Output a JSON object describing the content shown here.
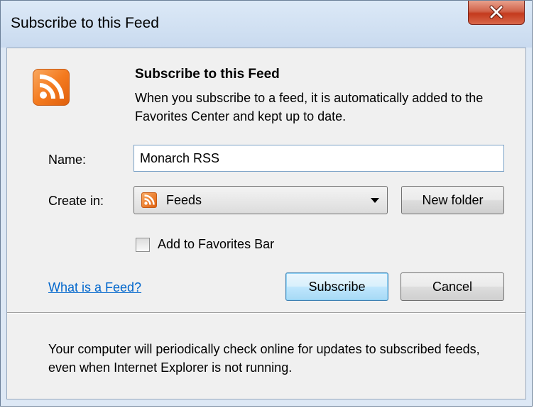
{
  "window": {
    "title": "Subscribe to this Feed"
  },
  "header": {
    "icon": "rss-feed-icon",
    "heading": "Subscribe to this Feed",
    "description": "When you subscribe to a feed, it is automatically added to the Favorites Center and kept up to date."
  },
  "form": {
    "name_label": "Name:",
    "name_value": "Monarch RSS",
    "create_in_label": "Create in:",
    "create_in_value": "Feeds",
    "new_folder_label": "New folder",
    "favorites_bar_label": "Add to Favorites Bar",
    "favorites_bar_checked": false
  },
  "actions": {
    "help_link": "What is a Feed?",
    "subscribe_label": "Subscribe",
    "cancel_label": "Cancel"
  },
  "footer": {
    "note": "Your computer will periodically check online for updates to subscribed feeds, even when Internet Explorer is not running."
  },
  "colors": {
    "rss_orange": "#f47b20",
    "link_blue": "#0066cc",
    "close_red": "#c43a1d"
  }
}
